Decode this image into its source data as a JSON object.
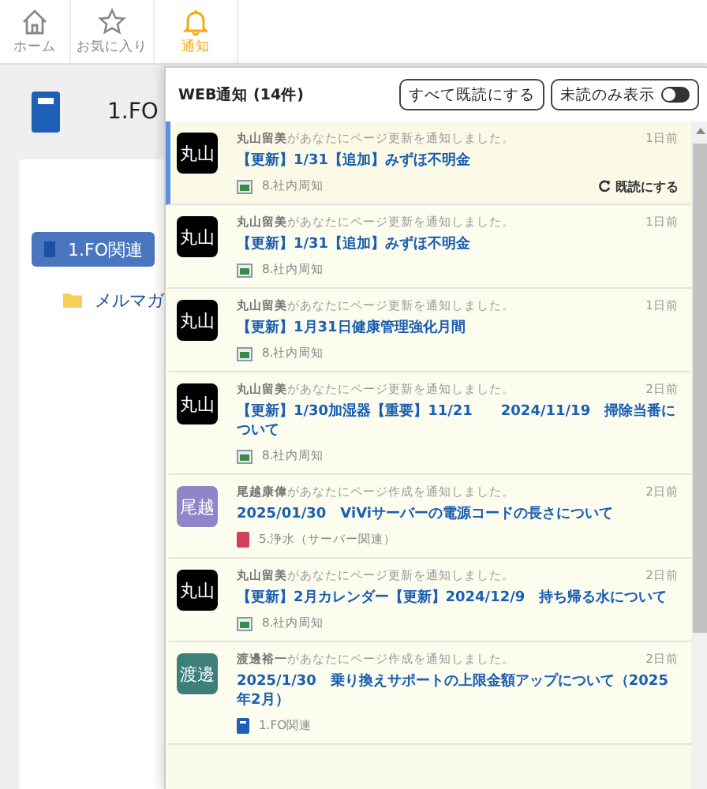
{
  "nav": [
    {
      "label": "ホーム",
      "selected": false
    },
    {
      "label": "お気に入り",
      "selected": false
    },
    {
      "label": "通知",
      "selected": true
    }
  ],
  "page": {
    "title": "1.FO",
    "tree": [
      {
        "label": "1.FO関連",
        "kind": "book",
        "selected": true
      },
      {
        "label": "メルマガ",
        "kind": "folder",
        "selected": false
      }
    ]
  },
  "notifications": {
    "title": "WEB通知 (14件)",
    "mark_all_button": "すべて既読にする",
    "unread_only": {
      "label": "未読のみ表示",
      "on": false
    },
    "items": [
      {
        "avatar": "丸山",
        "color": "#000000",
        "author": "丸山留美",
        "message": "があなたにページ更新を通知しました。",
        "time": "1日前",
        "title": "【更新】1/31【追加】みずほ不明金",
        "category": "8.社内周知",
        "kind": "page",
        "selected": true,
        "mark_read": "既読にする"
      },
      {
        "avatar": "丸山",
        "color": "#000000",
        "author": "丸山留美",
        "message": "があなたにページ更新を通知しました。",
        "time": "1日前",
        "title": "【更新】1/31【追加】みずほ不明金",
        "category": "8.社内周知",
        "kind": "page",
        "selected": false
      },
      {
        "avatar": "丸山",
        "color": "#000000",
        "author": "丸山留美",
        "message": "があなたにページ更新を通知しました。",
        "time": "1日前",
        "title": "【更新】1月31日健康管理強化月間",
        "category": "8.社内周知",
        "kind": "page",
        "selected": false
      },
      {
        "avatar": "丸山",
        "color": "#000000",
        "author": "丸山留美",
        "message": "があなたにページ更新を通知しました。",
        "time": "2日前",
        "title": "【更新】1/30加湿器【重要】11/21　　2024/11/19　掃除当番について",
        "category": "8.社内周知",
        "kind": "page",
        "selected": false
      },
      {
        "avatar": "尾越",
        "color": "#8e86c8",
        "author": "尾越康偉",
        "message": "があなたにページ作成を通知しました。",
        "time": "2日前",
        "title": "2025/01/30　ViViサーバーの電源コードの長さについて",
        "category": "5.浄水（サーバー関連）",
        "kind": "redbook",
        "selected": false
      },
      {
        "avatar": "丸山",
        "color": "#000000",
        "author": "丸山留美",
        "message": "があなたにページ更新を通知しました。",
        "time": "2日前",
        "title": "【更新】2月カレンダー【更新】2024/12/9　持ち帰る水について",
        "category": "8.社内周知",
        "kind": "page",
        "selected": false
      },
      {
        "avatar": "渡邊",
        "color": "#3d7f7b",
        "author": "渡邊裕一",
        "message": "があなたにページ作成を通知しました。",
        "time": "2日前",
        "title": "2025/1/30　乗り換えサポートの上限金額アップについて（2025年2月）",
        "category": "1.FO関連",
        "kind": "bluebook",
        "selected": false
      }
    ]
  }
}
